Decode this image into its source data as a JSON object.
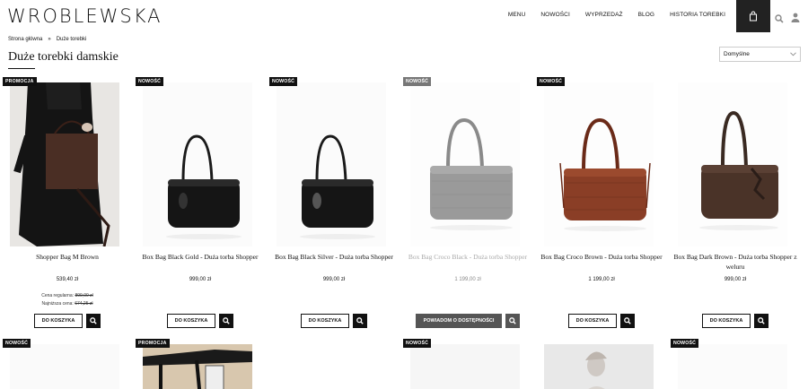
{
  "header": {
    "logo": "WROBLEWSKA",
    "nav": [
      "MENU",
      "NOWOŚCI",
      "WYPRZEDAŻ",
      "BLOG",
      "HISTORIA TOREBKI"
    ]
  },
  "breadcrumb": {
    "home": "Strona główna",
    "separator": "»",
    "current": "Duże torebki"
  },
  "page_title": "Duże torebki damskie",
  "sort": {
    "selected": "Domyślne"
  },
  "products": [
    {
      "badge": "PROMOCJA",
      "name": "Shopper Bag M Brown",
      "price": "539,40 zł",
      "regular_label": "Cena regularna:",
      "regular_price": "899,00 zł",
      "lowest_label": "Najniższa cena:",
      "lowest_price": "674,25 zł",
      "button": "DO KOSZYKA"
    },
    {
      "badge": "NOWOŚĆ",
      "name": "Box Bag Black Gold - Duża torba Shopper",
      "price": "999,00 zł",
      "button": "DO KOSZYKA"
    },
    {
      "badge": "NOWOŚĆ",
      "name": "Box Bag Black Silver - Duża torba Shopper",
      "price": "999,00 zł",
      "button": "DO KOSZYKA"
    },
    {
      "badge": "NOWOŚĆ",
      "name": "Box Bag Croco Black - Duża torba Shopper",
      "price": "1 199,00 zł",
      "button": "POWIADOM O DOSTĘPNOŚCI"
    },
    {
      "badge": "NOWOŚĆ",
      "name": "Box Bag Croco Brown - Duża torba Shopper",
      "price": "1 199,00 zł",
      "button": "DO KOSZYKA"
    },
    {
      "badge": "",
      "name": "Box Bag Dark Brown - Duża torba Shopper z weluru",
      "price": "999,00 zł",
      "button": "DO KOSZYKA"
    }
  ],
  "row2_badges": [
    "NOWOŚĆ",
    "PROMOCJA",
    "",
    "NOWOŚĆ",
    "",
    "NOWOŚĆ"
  ],
  "colors": {
    "dark": "#111111",
    "disabled": "#555555",
    "brown": "#5a3a2e",
    "croco_brown": "#8a3e26"
  }
}
